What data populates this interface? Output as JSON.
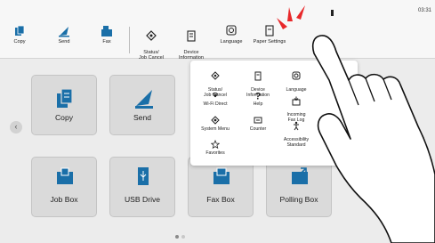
{
  "status": {
    "time": "03:31"
  },
  "toolbar": {
    "items": [
      {
        "label": "Copy",
        "icon": "copy-icon"
      },
      {
        "label": "Send",
        "icon": "send-icon"
      },
      {
        "label": "Fax",
        "icon": "fax-icon"
      },
      {
        "label": "Status/\nJob Cancel",
        "icon": "status-icon"
      },
      {
        "label": "Device\nInformation",
        "icon": "device-info-icon"
      },
      {
        "label": "Language",
        "icon": "language-icon"
      },
      {
        "label": "Paper Settings",
        "icon": "paper-settings-icon"
      }
    ]
  },
  "tiles": [
    {
      "label": "Copy",
      "icon": "copy-icon"
    },
    {
      "label": "Send",
      "icon": "send-icon"
    },
    {
      "label": "Job Box",
      "icon": "job-box-icon"
    },
    {
      "label": "USB Drive",
      "icon": "usb-drive-icon"
    },
    {
      "label": "Fax Box",
      "icon": "fax-box-icon"
    },
    {
      "label": "Polling Box",
      "icon": "polling-box-icon"
    }
  ],
  "popup": {
    "items": [
      {
        "label": "Status/\nJob Cancel",
        "icon": "status-icon"
      },
      {
        "label": "Device\nInformation",
        "icon": "device-info-icon"
      },
      {
        "label": "Language",
        "icon": "language-icon"
      },
      {
        "label": "Wi-Fi Direct",
        "icon": "wifi-direct-icon"
      },
      {
        "label": "Help",
        "icon": "help-icon"
      },
      {
        "label": "Incoming\nFax Log",
        "icon": "incoming-fax-log-icon"
      },
      {
        "label": "System Menu",
        "icon": "system-menu-icon"
      },
      {
        "label": "Counter",
        "icon": "counter-icon"
      },
      {
        "label": "Accessibility\nStandard",
        "icon": "accessibility-icon"
      },
      {
        "label": "Favorites",
        "icon": "favorites-icon"
      }
    ]
  },
  "colors": {
    "accent": "#1a6fa8",
    "tile_bg": "#dadada",
    "screen_bg": "#ececec",
    "alert_red": "#e8282a"
  }
}
